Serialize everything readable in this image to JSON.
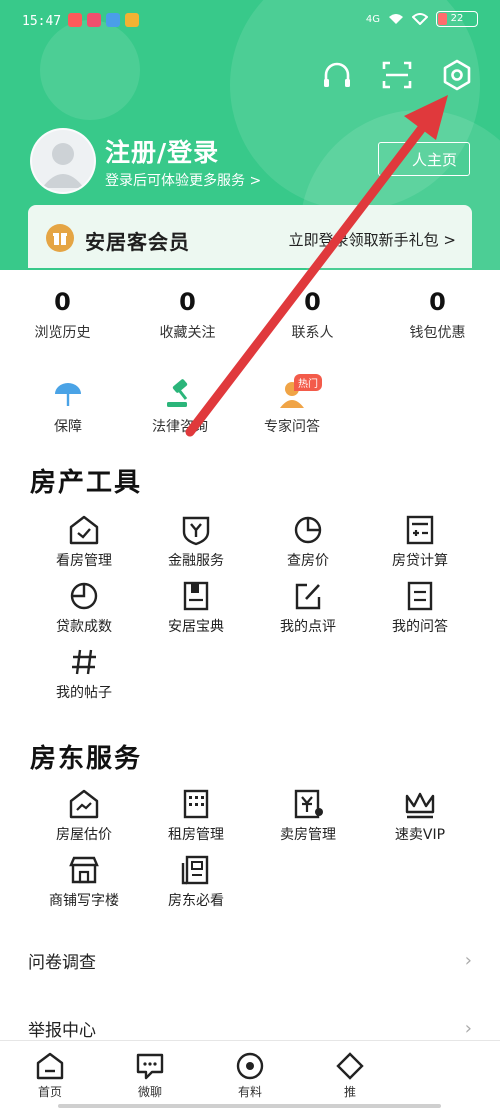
{
  "status_bar": {
    "time": "15:47",
    "network": "4G",
    "battery": "22"
  },
  "header": {
    "icons": [
      "headset-icon",
      "scan-icon",
      "settings-icon"
    ],
    "login_title": "注册/登录",
    "login_subtitle": "登录后可体验更多服务 >",
    "homepage_button": "人主页"
  },
  "member": {
    "title": "安居客会员",
    "cta": "立即登录领取新手礼包 >"
  },
  "stats": [
    {
      "value": "0",
      "label": "浏览历史"
    },
    {
      "value": "0",
      "label": "收藏关注"
    },
    {
      "value": "0",
      "label": "联系人"
    },
    {
      "value": "0",
      "label": "钱包优惠"
    }
  ],
  "quick_actions": [
    {
      "label": "保障",
      "icon": "umbrella-icon"
    },
    {
      "label": "法律咨询",
      "icon": "gavel-icon"
    },
    {
      "label": "专家问答",
      "icon": "expert-icon",
      "badge": "热门"
    }
  ],
  "property_tools": {
    "title": "房产工具",
    "items": [
      {
        "label": "看房管理",
        "icon": "house-check-icon"
      },
      {
        "label": "金融服务",
        "icon": "finance-shield-icon"
      },
      {
        "label": "查房价",
        "icon": "pie-chart-icon"
      },
      {
        "label": "房贷计算",
        "icon": "calculator-icon"
      },
      {
        "label": "贷款成数",
        "icon": "loan-pie-icon"
      },
      {
        "label": "安居宝典",
        "icon": "book-icon"
      },
      {
        "label": "我的点评",
        "icon": "edit-icon"
      },
      {
        "label": "我的问答",
        "icon": "qa-doc-icon"
      },
      {
        "label": "我的帖子",
        "icon": "hashtag-icon"
      }
    ]
  },
  "landlord_services": {
    "title": "房东服务",
    "items": [
      {
        "label": "房屋估价",
        "icon": "house-chart-icon"
      },
      {
        "label": "租房管理",
        "icon": "building-icon"
      },
      {
        "label": "卖房管理",
        "icon": "yuan-doc-icon"
      },
      {
        "label": "速卖VIP",
        "icon": "crown-icon"
      },
      {
        "label": "商铺写字楼",
        "icon": "shop-icon"
      },
      {
        "label": "房东必看",
        "icon": "doc-list-icon"
      }
    ]
  },
  "list_rows": [
    {
      "label": "问卷调查"
    },
    {
      "label": "举报中心"
    }
  ],
  "bottom_nav": [
    {
      "label": "首页",
      "icon": "home-icon"
    },
    {
      "label": "微聊",
      "icon": "chat-icon"
    },
    {
      "label": "有料",
      "icon": "target-icon"
    },
    {
      "label": "推",
      "icon": "diamond-icon"
    }
  ],
  "colors": {
    "brand": "#38c98a",
    "annotation_arrow": "#e0393c",
    "hot_badge": "#f35b4a"
  }
}
